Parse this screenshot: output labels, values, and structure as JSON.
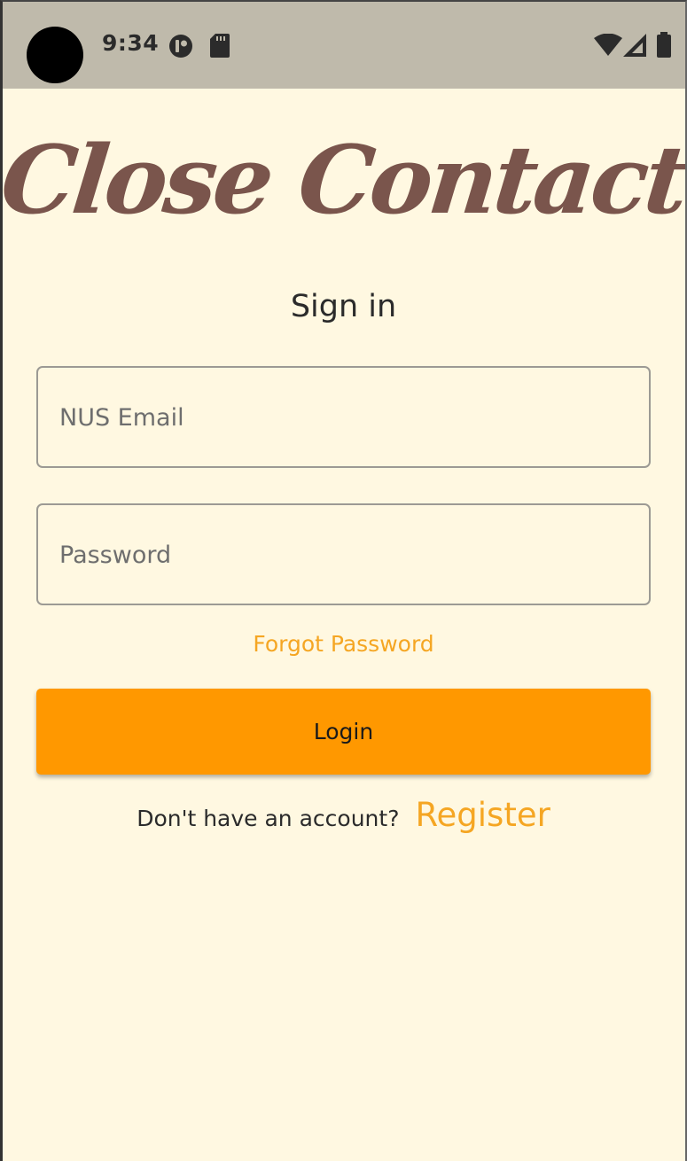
{
  "status_bar": {
    "time": "9:34",
    "icons": [
      "camera-punch-hole",
      "app-notification-icon",
      "sd-card-icon",
      "wifi-icon",
      "signal-icon",
      "battery-icon"
    ]
  },
  "app": {
    "logo_text": "Close Contact",
    "title": "Sign in"
  },
  "form": {
    "email_placeholder": "NUS Email",
    "email_value": "",
    "password_placeholder": "Password",
    "password_value": "",
    "forgot_label": "Forgot Password",
    "login_label": "Login"
  },
  "footer": {
    "prompt": "Don't have an account?",
    "register_label": "Register"
  },
  "colors": {
    "background": "#fff8e1",
    "status_bar": "#bfbaab",
    "logo": "#7a554c",
    "accent": "#ff9800",
    "link": "#f5a623"
  }
}
